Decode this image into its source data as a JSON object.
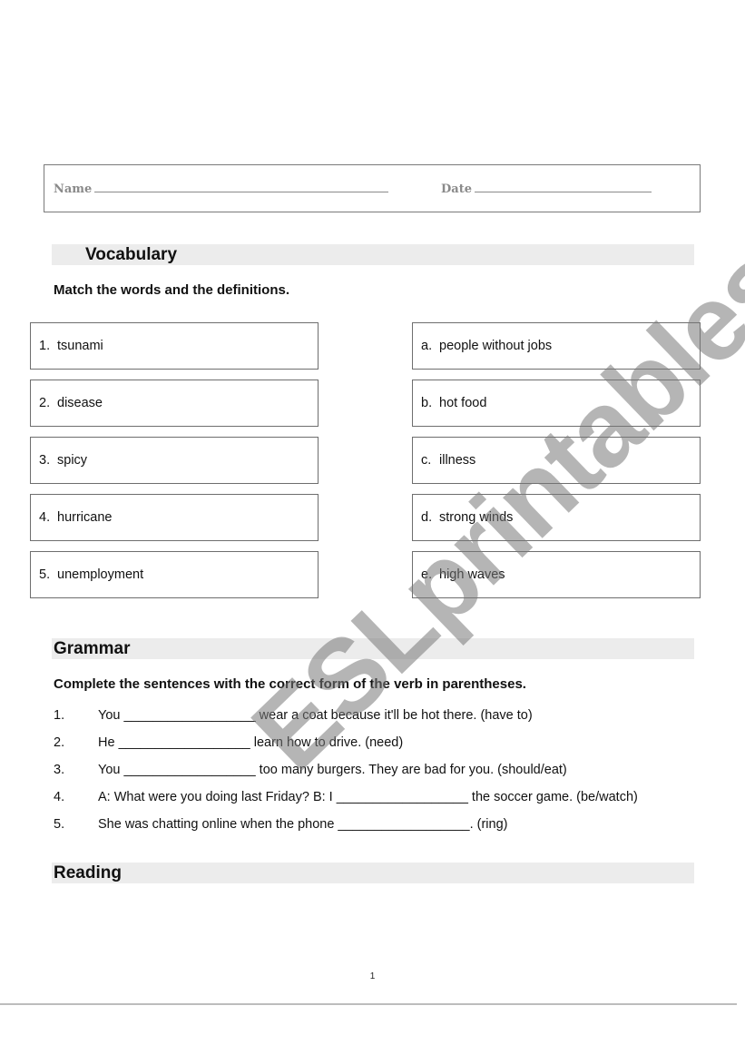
{
  "header": {
    "name_label": "Name",
    "date_label": "Date"
  },
  "vocabulary": {
    "title": "Vocabulary",
    "instruction": "Match the words and the definitions.",
    "words": [
      {
        "num": "1.",
        "text": "tsunami"
      },
      {
        "num": "2.",
        "text": "disease"
      },
      {
        "num": "3.",
        "text": "spicy"
      },
      {
        "num": "4.",
        "text": "hurricane"
      },
      {
        "num": "5.",
        "text": "unemployment"
      }
    ],
    "definitions": [
      {
        "letter": "a.",
        "text": "people without jobs"
      },
      {
        "letter": "b.",
        "text": "hot food"
      },
      {
        "letter": "c.",
        "text": "illness"
      },
      {
        "letter": "d.",
        "text": "strong winds"
      },
      {
        "letter": "e.",
        "text": "high waves"
      }
    ]
  },
  "grammar": {
    "title": "Grammar",
    "instruction": "Complete the sentences with the correct form of the verb in parentheses.",
    "sentences": [
      {
        "num": "1.",
        "text": "You __________________ wear a coat because it'll be hot there. (have to)"
      },
      {
        "num": "2.",
        "text": "He __________________ learn how to drive. (need)"
      },
      {
        "num": "3.",
        "text": "You __________________ too many burgers. They are bad for you. (should/eat)"
      },
      {
        "num": "4.",
        "text": "A: What were you doing last Friday? B: I __________________ the soccer game. (be/watch)"
      },
      {
        "num": "5.",
        "text": "She was chatting online when the phone __________________. (ring)"
      }
    ]
  },
  "reading": {
    "title": "Reading"
  },
  "footer": {
    "page_number": "1"
  },
  "watermark": {
    "text": "ESLprintables.com"
  }
}
